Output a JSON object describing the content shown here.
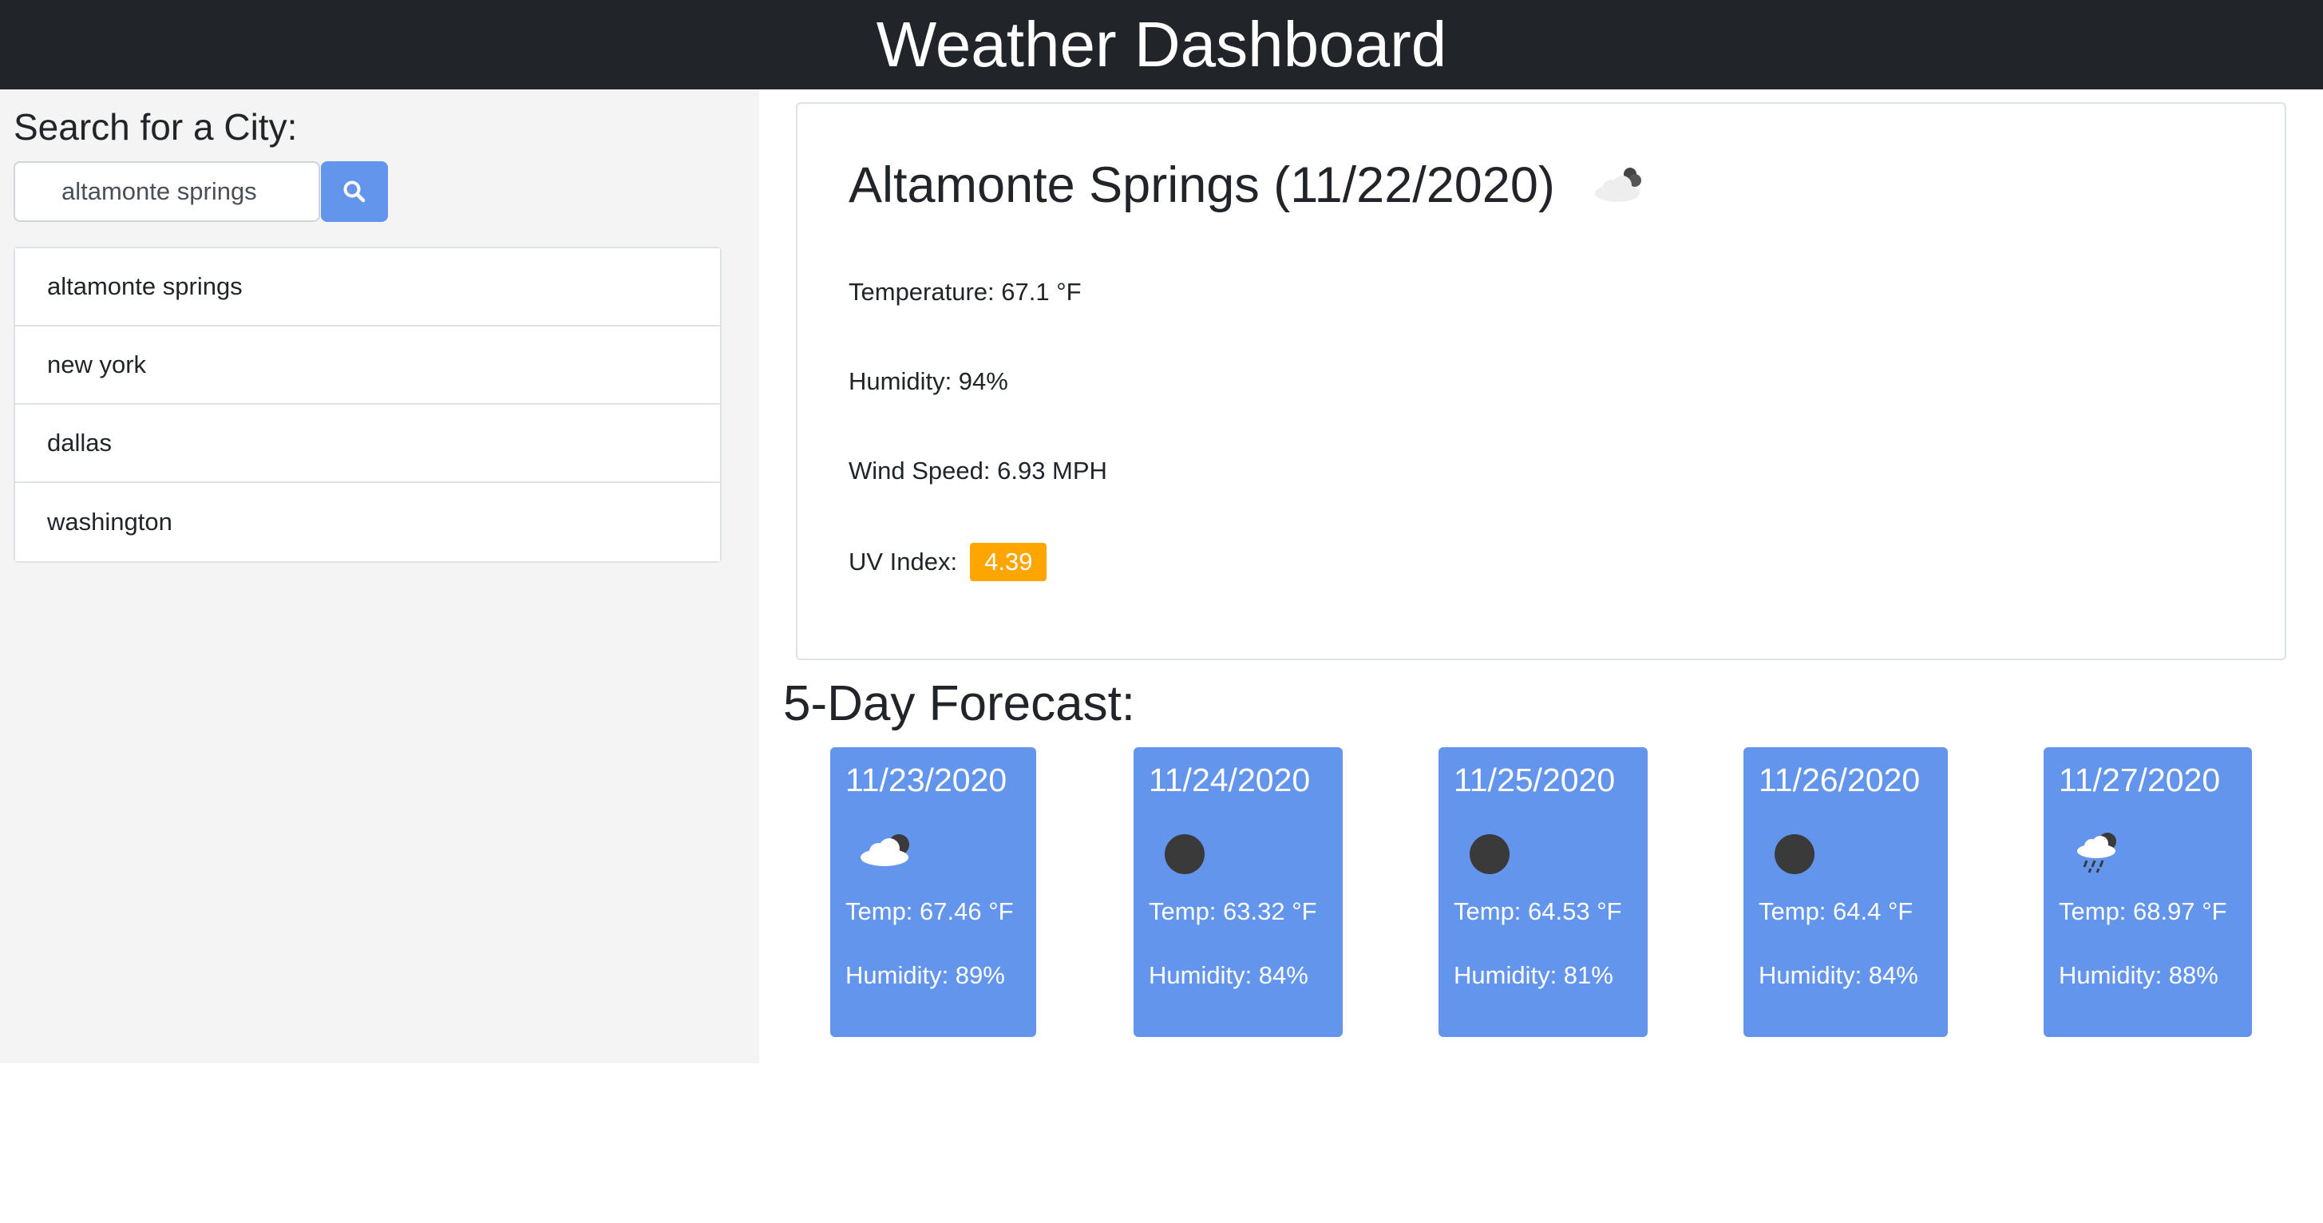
{
  "header": {
    "title": "Weather Dashboard"
  },
  "search": {
    "label": "Search for a City:",
    "value": "altamonte springs",
    "button_icon": "search-icon"
  },
  "history": [
    "altamonte springs",
    "new york",
    "dallas",
    "washington"
  ],
  "current": {
    "title": "Altamonte Springs (11/22/2020)",
    "icon": "cloudy-night-icon",
    "temperature": "Temperature: 67.1 °F",
    "humidity": "Humidity: 94%",
    "wind": "Wind Speed: 6.93 MPH",
    "uv_label": "UV Index:",
    "uv_value": "4.39",
    "uv_color": "#ffa500"
  },
  "forecast": {
    "title": "5-Day Forecast:",
    "card_color": "#6495ed",
    "days": [
      {
        "date": "11/23/2020",
        "icon": "partly-cloudy-night-icon",
        "temp": "Temp: 67.46 °F",
        "humidity": "Humidity: 89%"
      },
      {
        "date": "11/24/2020",
        "icon": "clear-night-icon",
        "temp": "Temp: 63.32 °F",
        "humidity": "Humidity: 84%"
      },
      {
        "date": "11/25/2020",
        "icon": "clear-night-icon",
        "temp": "Temp: 64.53 °F",
        "humidity": "Humidity: 81%"
      },
      {
        "date": "11/26/2020",
        "icon": "clear-night-icon",
        "temp": "Temp: 64.4 °F",
        "humidity": "Humidity: 84%"
      },
      {
        "date": "11/27/2020",
        "icon": "rain-night-icon",
        "temp": "Temp: 68.97 °F",
        "humidity": "Humidity: 88%"
      }
    ]
  }
}
